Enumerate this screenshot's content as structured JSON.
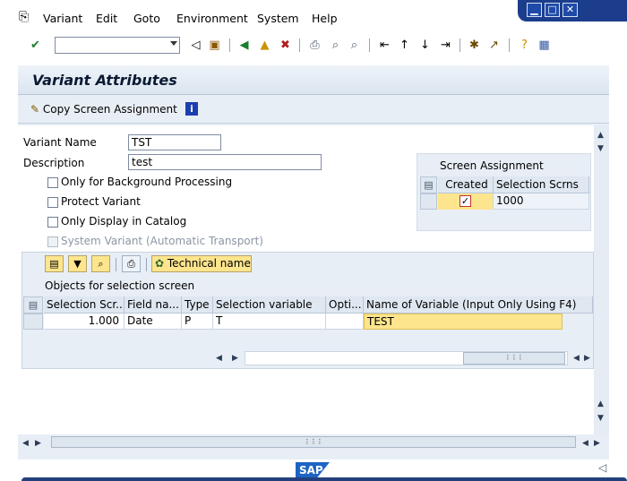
{
  "menu": {
    "items": [
      "Variant",
      "Edit",
      "Goto",
      "Environment",
      "System",
      "Help"
    ],
    "underlines": [
      "V",
      "E",
      "G",
      "n",
      "S",
      "H"
    ]
  },
  "window_controls": {
    "minimize": "▁",
    "maximize": "□",
    "close": "✕"
  },
  "toolbar": {
    "command_field": {
      "value": "",
      "placeholder": ""
    }
  },
  "title": "Variant Attributes",
  "app_toolbar": {
    "copy_screen_assignment": "Copy Screen Assignment",
    "info_icon": "i"
  },
  "form": {
    "variant_name_label": "Variant Name",
    "variant_name_value": "TST",
    "description_label": "Description",
    "description_value": "test",
    "checkboxes": [
      {
        "label": "Only for Background Processing",
        "checked": false
      },
      {
        "label": "Protect Variant",
        "checked": false
      },
      {
        "label": "Only Display in Catalog",
        "checked": false
      },
      {
        "label": "System Variant (Automatic Transport)",
        "checked": false,
        "disabled": true
      }
    ]
  },
  "screen_assignment": {
    "title": "Screen Assignment",
    "headers": [
      "Created",
      "Selection Scrns"
    ],
    "rows": [
      {
        "created": true,
        "selection_scrns": "1000"
      }
    ]
  },
  "objects_table": {
    "technical_name_button": "Technical name",
    "caption": "Objects for selection screen",
    "headers": [
      "Selection Scr...",
      "Field na...",
      "Type",
      "Selection variable",
      "Opti...",
      "Name of Variable (Input Only Using F4)"
    ],
    "rows": [
      [
        "1.000",
        "Date",
        "P",
        "T",
        "",
        "TEST"
      ]
    ]
  },
  "footer": {
    "logo": "SAP"
  }
}
